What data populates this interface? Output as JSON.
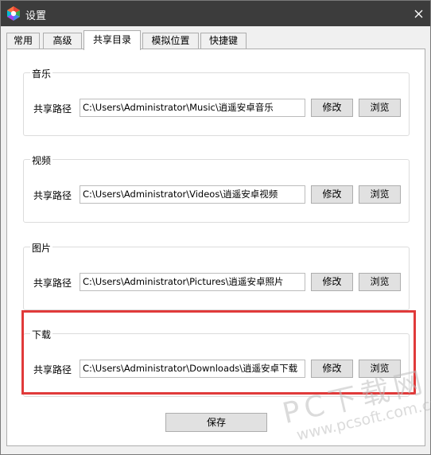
{
  "window": {
    "title": "设置",
    "close": "×"
  },
  "tabs": [
    {
      "label": "常用"
    },
    {
      "label": "高级"
    },
    {
      "label": "共享目录"
    },
    {
      "label": "模拟位置"
    },
    {
      "label": "快捷键"
    }
  ],
  "active_tab": "共享目录",
  "groups": [
    {
      "title": "音乐",
      "path_label": "共享路径",
      "path": "C:\\Users\\Administrator\\Music\\逍遥安卓音乐",
      "modify": "修改",
      "browse": "浏览"
    },
    {
      "title": "视频",
      "path_label": "共享路径",
      "path": "C:\\Users\\Administrator\\Videos\\逍遥安卓视频",
      "modify": "修改",
      "browse": "浏览"
    },
    {
      "title": "图片",
      "path_label": "共享路径",
      "path": "C:\\Users\\Administrator\\Pictures\\逍遥安卓照片",
      "modify": "修改",
      "browse": "浏览"
    },
    {
      "title": "下载",
      "path_label": "共享路径",
      "path": "C:\\Users\\Administrator\\Downloads\\逍遥安卓下载",
      "modify": "修改",
      "browse": "浏览"
    }
  ],
  "save_label": "保存",
  "watermark": {
    "logo": "PC下载网",
    "url": "www.pcsoft.com.cn"
  },
  "colors": {
    "titlebar": "#3c3c3c",
    "highlight": "#e03a3a"
  }
}
